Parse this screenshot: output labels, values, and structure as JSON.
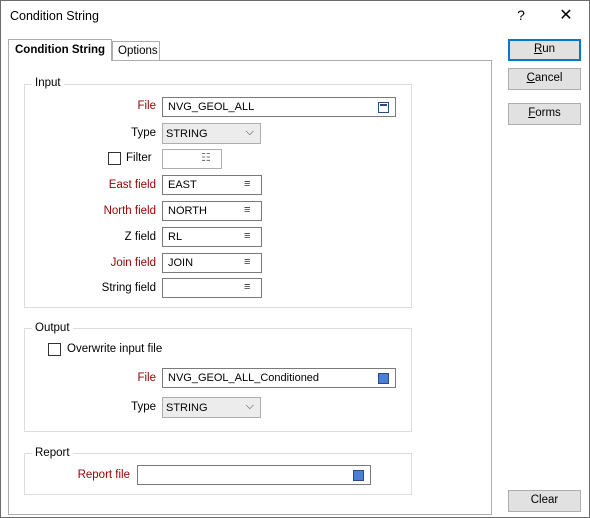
{
  "window": {
    "title": "Condition String",
    "help_glyph": "?",
    "close_glyph": "✕"
  },
  "tabs": [
    {
      "label": "Condition String"
    },
    {
      "label": "Options"
    }
  ],
  "input": {
    "legend": "Input",
    "file_label": "File",
    "file_value": "NVG_GEOL_ALL",
    "type_label": "Type",
    "type_value": "STRING",
    "filter_label": "Filter",
    "filter_value": "",
    "east_label": "East field",
    "east_value": "EAST",
    "north_label": "North field",
    "north_value": "NORTH",
    "z_label": "Z field",
    "z_value": "RL",
    "join_label": "Join field",
    "join_value": "JOIN",
    "string_label": "String field",
    "string_value": ""
  },
  "output": {
    "legend": "Output",
    "overwrite_label": "Overwrite input file",
    "file_label": "File",
    "file_value": "NVG_GEOL_ALL_Conditioned",
    "type_label": "Type",
    "type_value": "STRING"
  },
  "report": {
    "legend": "Report",
    "file_label": "Report file",
    "file_value": ""
  },
  "buttons": {
    "run": {
      "first": "R",
      "rest": "un"
    },
    "cancel": {
      "first": "C",
      "rest": "ancel"
    },
    "forms": {
      "first": "F",
      "rest": "orms"
    },
    "clear": "Clear"
  },
  "icons": {
    "dropdown": "chevron-down-icon",
    "list": "list-icon",
    "picker": "file-picker-icon"
  }
}
